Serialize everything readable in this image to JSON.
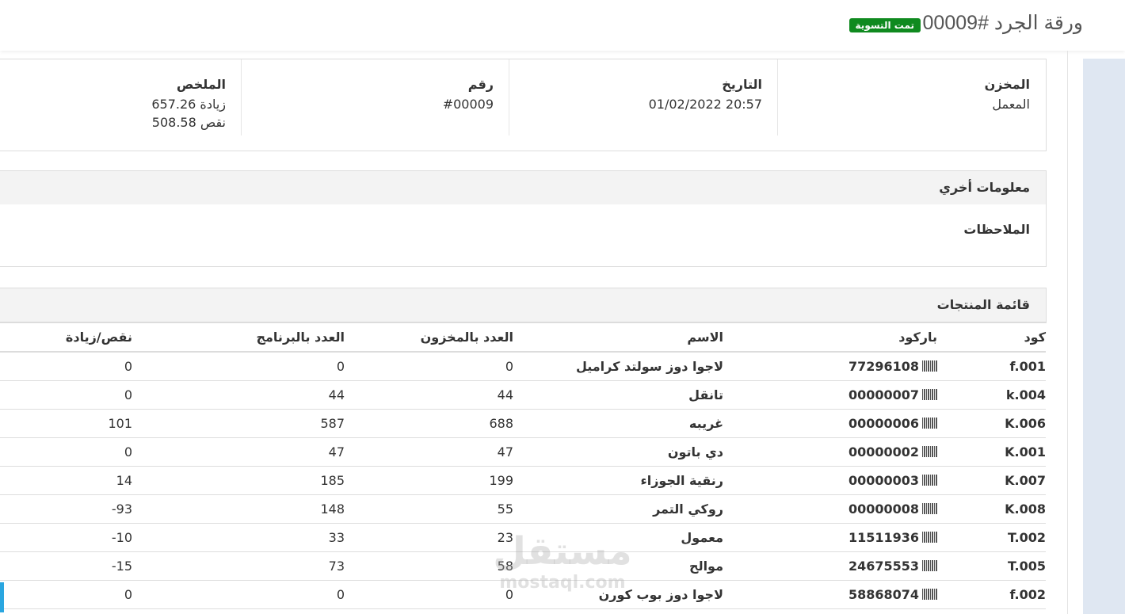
{
  "header": {
    "title": "ورقة الجرد #00009",
    "status": "تمت التسوية"
  },
  "info": {
    "warehouse_label": "المخزن",
    "warehouse_value": "المعمل",
    "date_label": "التاريخ",
    "date_value": "20:57 01/02/2022",
    "number_label": "رقم",
    "number_value": "#00009",
    "summary_label": "الملخص",
    "summary_increase": "زيادة 657.26",
    "summary_decrease": "نقص 508.58"
  },
  "other_info": {
    "title": "معلومات أخري",
    "notes_label": "الملاحظات"
  },
  "products": {
    "title": "قائمة المنتجات",
    "columns": {
      "code": "كود",
      "barcode": "باركود",
      "name": "الاسم",
      "stock": "العدد بالمخزون",
      "program": "العدد بالبرنامج",
      "diff": "نقص/زيادة"
    },
    "rows": [
      {
        "code": "f.001",
        "barcode": "77296108",
        "name": "لاجوا دوز سولتد كراميل",
        "stock": "0",
        "program": "0",
        "diff": "0"
      },
      {
        "code": "k.004",
        "barcode": "00000007",
        "name": "تانقل",
        "stock": "44",
        "program": "44",
        "diff": "0"
      },
      {
        "code": "K.006",
        "barcode": "00000006",
        "name": "غريبه",
        "stock": "688",
        "program": "587",
        "diff": "101"
      },
      {
        "code": "K.001",
        "barcode": "00000002",
        "name": "دي باتون",
        "stock": "47",
        "program": "47",
        "diff": "0"
      },
      {
        "code": "K.007",
        "barcode": "00000003",
        "name": "رنقية الجوزاء",
        "stock": "199",
        "program": "185",
        "diff": "14"
      },
      {
        "code": "K.008",
        "barcode": "00000008",
        "name": "روكي التمر",
        "stock": "55",
        "program": "148",
        "diff": "93-"
      },
      {
        "code": "T.002",
        "barcode": "11511936",
        "name": "معمول",
        "stock": "23",
        "program": "33",
        "diff": "10-"
      },
      {
        "code": "T.005",
        "barcode": "24675553",
        "name": "موالح",
        "stock": "58",
        "program": "73",
        "diff": "15-"
      },
      {
        "code": "f.002",
        "barcode": "58868074",
        "name": "لاجوا دوز بوب كورن",
        "stock": "0",
        "program": "0",
        "diff": "0"
      }
    ]
  },
  "watermark": {
    "brand": "مستقل",
    "domain": "mostaql.com"
  },
  "icons": {
    "barcode": "barcode-icon"
  }
}
